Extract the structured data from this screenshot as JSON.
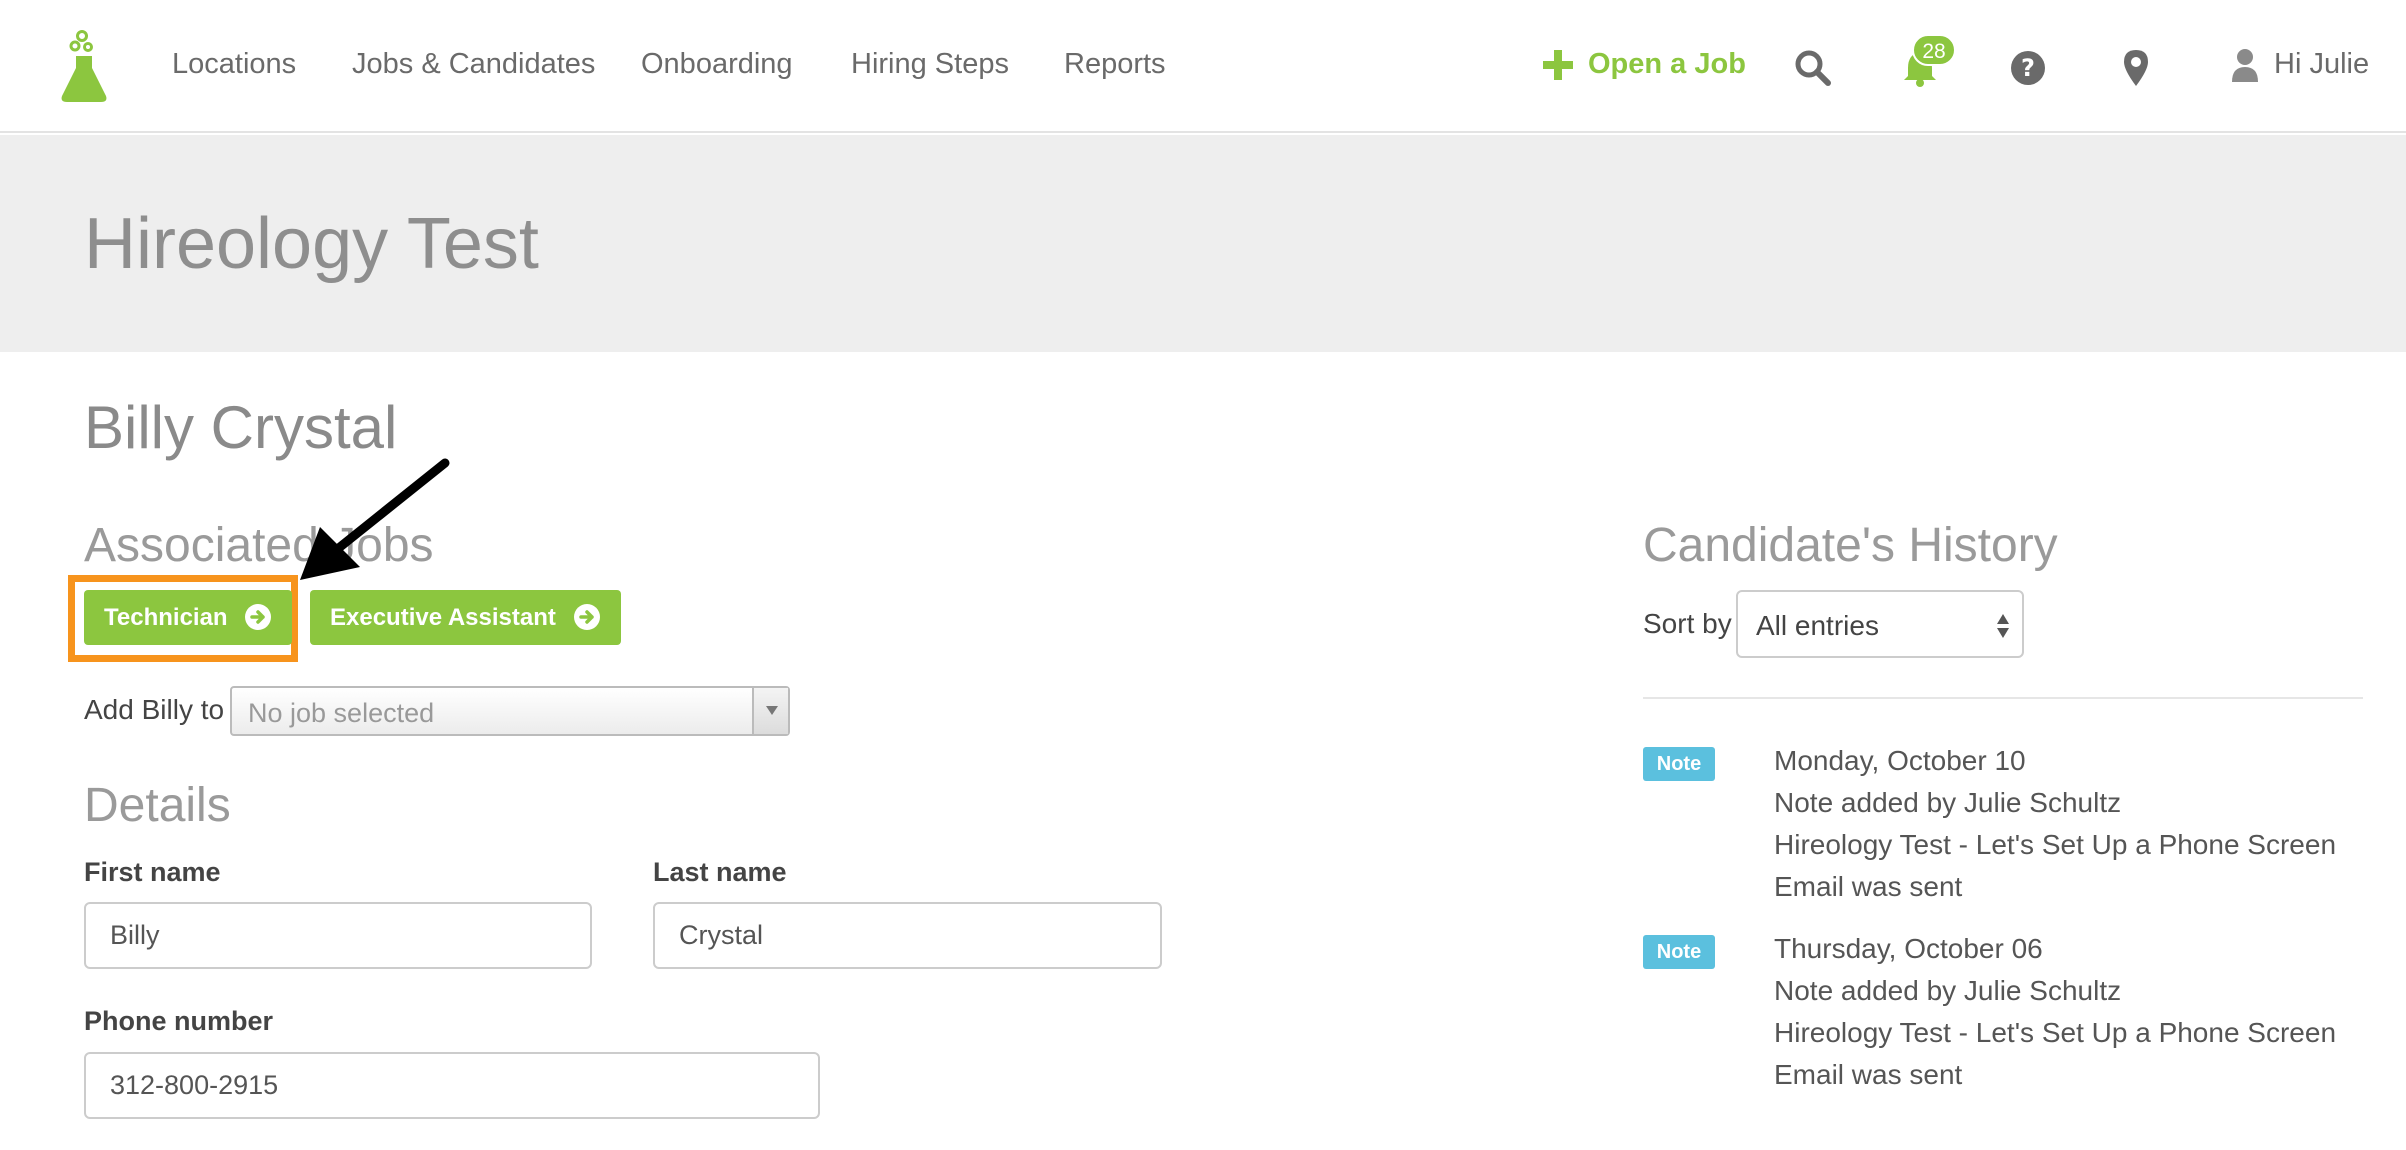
{
  "nav": {
    "links": [
      "Locations",
      "Jobs & Candidates",
      "Onboarding",
      "Hiring Steps",
      "Reports"
    ],
    "open_job": "Open a Job",
    "notification_count": "28",
    "greeting": "Hi Julie"
  },
  "banner": {
    "title": "Hireology Test"
  },
  "candidate": {
    "name": "Billy Crystal",
    "associated_jobs_heading": "Associated Jobs",
    "jobs": [
      "Technician",
      "Executive Assistant"
    ],
    "add_label": "Add Billy to",
    "add_placeholder": "No job selected",
    "details_heading": "Details",
    "fields": {
      "first_name_label": "First name",
      "first_name": "Billy",
      "last_name_label": "Last name",
      "last_name": "Crystal",
      "phone_label": "Phone number",
      "phone": "312-800-2915"
    }
  },
  "history": {
    "heading": "Candidate's History",
    "sort_label": "Sort by",
    "sort_value": "All entries",
    "entries": [
      {
        "badge": "Note",
        "date": "Monday, October 10",
        "line1": "Note added by Julie Schultz",
        "line2": "Hireology Test - Let's Set Up a Phone Screen",
        "line3": "Email was sent"
      },
      {
        "badge": "Note",
        "date": "Thursday, October 06",
        "line1": "Note added by Julie Schultz",
        "line2": "Hireology Test - Let's Set Up a Phone Screen",
        "line3": "Email was sent"
      }
    ]
  },
  "colors": {
    "brand_green": "#8cc63f",
    "highlight_orange": "#f7941d",
    "note_blue": "#5bc0de"
  },
  "icons": [
    "flask-logo-icon",
    "plus-icon",
    "search-icon",
    "bell-icon",
    "help-icon",
    "map-pin-icon",
    "user-icon",
    "arrow-circle-right-icon",
    "chevron-down-icon",
    "sort-arrows-icon"
  ]
}
